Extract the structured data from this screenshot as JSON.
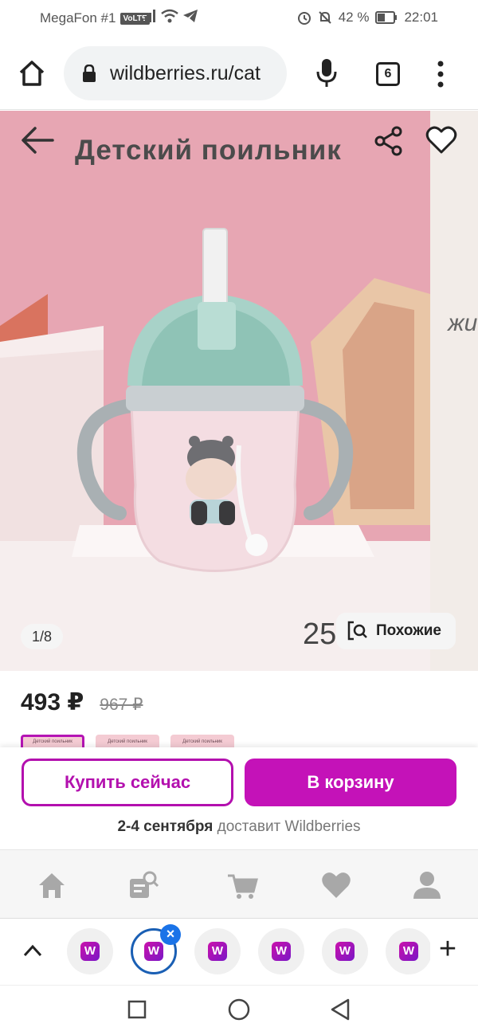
{
  "status_bar": {
    "carrier": "MegaFon #1",
    "volte": "VoLTE",
    "battery": "42 %",
    "time": "22:01"
  },
  "browser": {
    "url": "wildberries.ru/cat",
    "tab_count": "6"
  },
  "gallery": {
    "image_title": "Детский поильник",
    "counter": "1/8",
    "partial_number": "25",
    "similar_label": "Похожие",
    "peek_text": "жи"
  },
  "product": {
    "price": "493 ₽",
    "old_price": "967 ₽",
    "thumb_caption": "Детский поильник"
  },
  "actions": {
    "buy_now": "Купить сейчас",
    "add_to_cart": "В корзину",
    "delivery_dates": "2-4 сентября",
    "delivery_text": " доставит Wildberries"
  },
  "bottom_nav": [
    "home-icon",
    "catalog-search-icon",
    "cart-icon",
    "favorites-icon",
    "profile-icon"
  ],
  "tab_strip": {
    "tab_logo": "W",
    "close_symbol": "×",
    "add_symbol": "+"
  },
  "colors": {
    "brand": "#c412b8",
    "brand_outline": "#b310ae",
    "background_pink": "#e9a7b5"
  }
}
